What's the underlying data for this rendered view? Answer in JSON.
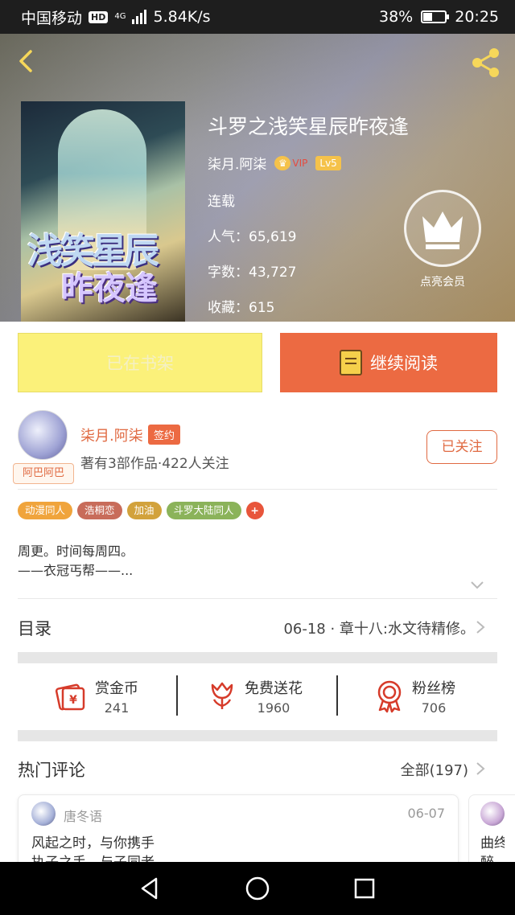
{
  "status_bar": {
    "carrier": "中国移动",
    "hd": "HD",
    "network": "4G",
    "speed": "5.84K/s",
    "battery": "38%",
    "battery_level": 0.38,
    "time": "20:25"
  },
  "book": {
    "cover_line1": "浅笑星辰",
    "cover_line2": "昨夜逢",
    "title": "斗罗之浅笑星辰昨夜逢",
    "author": "柒月.阿柒",
    "vip_label": "VIP",
    "level": "Lv5",
    "status": "连载",
    "popularity_label": "人气：65,619",
    "words_label": "字数：43,727",
    "favorites_label": "收藏：615",
    "member_label": "点亮会员"
  },
  "actions": {
    "shelf_label": "已在书架",
    "read_label": "继续阅读"
  },
  "author_card": {
    "avatar_tag": "阿巴阿巴",
    "name": "柒月.阿柒",
    "signed": "签约",
    "subtitle": "著有3部作品·422人关注",
    "follow_label": "已关注"
  },
  "tags": [
    {
      "label": "动漫同人",
      "color": "#f0a43c"
    },
    {
      "label": "浩桐恋",
      "color": "#c86c5a"
    },
    {
      "label": "加油",
      "color": "#d2a23c"
    },
    {
      "label": "斗罗大陆同人",
      "color": "#8bb35a"
    },
    {
      "label": "+",
      "color": "#e8553b"
    }
  ],
  "description": {
    "line1": "周更。时间每周四。",
    "line2": "——衣冠丐帮——..."
  },
  "toc": {
    "label": "目录",
    "latest": "06-18 · 章十八:水文待精修。"
  },
  "stats": [
    {
      "label": "赏金币",
      "value": "241",
      "icon": "red-envelope-icon"
    },
    {
      "label": "免费送花",
      "value": "1960",
      "icon": "flower-icon"
    },
    {
      "label": "粉丝榜",
      "value": "706",
      "icon": "medal-icon"
    }
  ],
  "comments": {
    "title": "热门评论",
    "all_label": "全部(197)",
    "items": [
      {
        "user": "唐冬语",
        "date": "06-07",
        "line1": "风起之时，与你携手",
        "line2": "执子之手，与子同老"
      },
      {
        "line1": "曲终",
        "line2": "醉"
      }
    ]
  },
  "colors": {
    "accent": "#ec6a42",
    "shelf_button": "#fbf17a",
    "back_icon": "#f6d75a"
  }
}
